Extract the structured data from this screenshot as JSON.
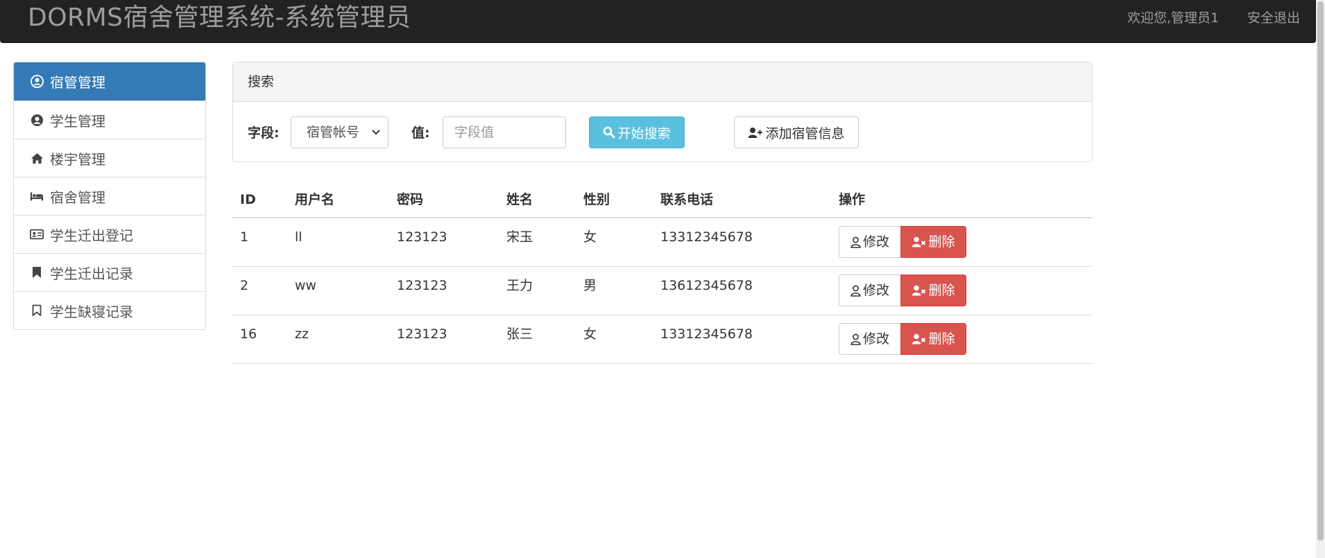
{
  "navbar": {
    "brand": "DORMS宿舍管理系统-系统管理员",
    "welcome": "欢迎您,管理员1",
    "logout": "安全退出"
  },
  "sidebar": {
    "items": [
      {
        "label": "宿管管理",
        "icon": "user-circle-icon",
        "active": true
      },
      {
        "label": "学生管理",
        "icon": "user-circle-icon",
        "active": false
      },
      {
        "label": "楼宇管理",
        "icon": "home-icon",
        "active": false
      },
      {
        "label": "宿舍管理",
        "icon": "bed-icon",
        "active": false
      },
      {
        "label": "学生迁出登记",
        "icon": "id-card-icon",
        "active": false
      },
      {
        "label": "学生迁出记录",
        "icon": "bookmark-solid-icon",
        "active": false
      },
      {
        "label": "学生缺寝记录",
        "icon": "bookmark-outline-icon",
        "active": false
      }
    ],
    "active_color": "#337ab7"
  },
  "search": {
    "heading": "搜索",
    "field_label": "字段:",
    "field_selected": "宿管帐号",
    "value_label": "值:",
    "value_placeholder": "字段值",
    "search_button": "开始搜索",
    "add_button": "添加宿管信息",
    "search_button_color": "#5bc0de"
  },
  "table": {
    "headers": [
      "ID",
      "用户名",
      "密码",
      "姓名",
      "性别",
      "联系电话",
      "操作"
    ],
    "rows": [
      {
        "id": "1",
        "username": "ll",
        "password": "123123",
        "name": "宋玉",
        "sex": "女",
        "phone": "13312345678"
      },
      {
        "id": "2",
        "username": "ww",
        "password": "123123",
        "name": "王力",
        "sex": "男",
        "phone": "13612345678"
      },
      {
        "id": "16",
        "username": "zz",
        "password": "123123",
        "name": "张三",
        "sex": "女",
        "phone": "13312345678"
      }
    ],
    "edit_label": "修改",
    "delete_label": "删除",
    "delete_color": "#d9534f"
  }
}
